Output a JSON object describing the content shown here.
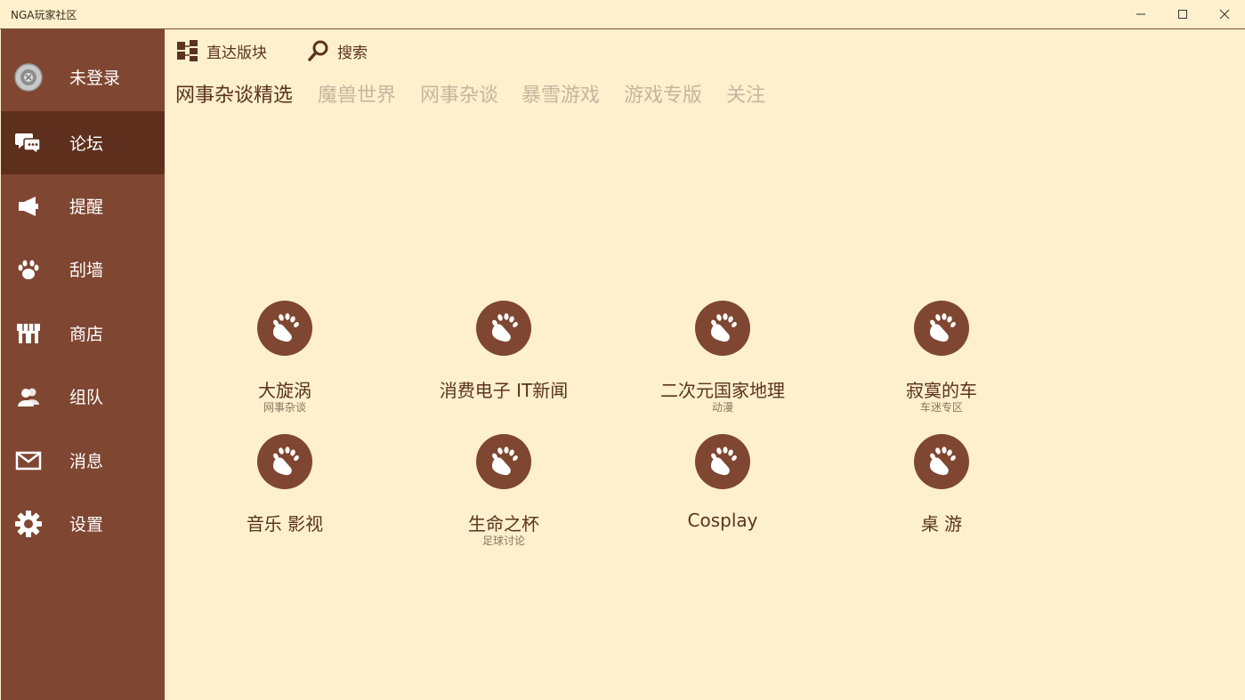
{
  "window": {
    "title": "NGA玩家社区"
  },
  "sidebar": {
    "items": [
      {
        "label": "未登录",
        "icon": "avatar-icon"
      },
      {
        "label": "论坛",
        "icon": "forum-chat-icon",
        "active": true
      },
      {
        "label": "提醒",
        "icon": "megaphone-icon"
      },
      {
        "label": "刮墙",
        "icon": "paw-icon"
      },
      {
        "label": "商店",
        "icon": "store-icon"
      },
      {
        "label": "组队",
        "icon": "team-icon"
      },
      {
        "label": "消息",
        "icon": "mail-icon"
      },
      {
        "label": "设置",
        "icon": "gear-icon"
      }
    ]
  },
  "toolbar": {
    "direct_label": "直达版块",
    "search_label": "搜索"
  },
  "tabs": [
    {
      "label": "网事杂谈精选",
      "active": true
    },
    {
      "label": "魔兽世界"
    },
    {
      "label": "网事杂谈"
    },
    {
      "label": "暴雪游戏"
    },
    {
      "label": "游戏专版"
    },
    {
      "label": "关注"
    }
  ],
  "boards": [
    {
      "name": "大旋涡",
      "sub": "网事杂谈"
    },
    {
      "name": "消费电子 IT新闻",
      "sub": ""
    },
    {
      "name": "二次元国家地理",
      "sub": "动漫"
    },
    {
      "name": "寂寞的车",
      "sub": "车迷专区"
    },
    {
      "name": "音乐 影视",
      "sub": ""
    },
    {
      "name": "生命之杯",
      "sub": "足球讨论"
    },
    {
      "name": "Cosplay",
      "sub": ""
    },
    {
      "name": "桌 游",
      "sub": ""
    }
  ],
  "colors": {
    "background": "#FEF0CC",
    "sidebar": "#7F4631",
    "sidebar_active": "#5E2F1D",
    "accent_text": "#5A3320",
    "inactive_tab": "#C9B49F"
  }
}
